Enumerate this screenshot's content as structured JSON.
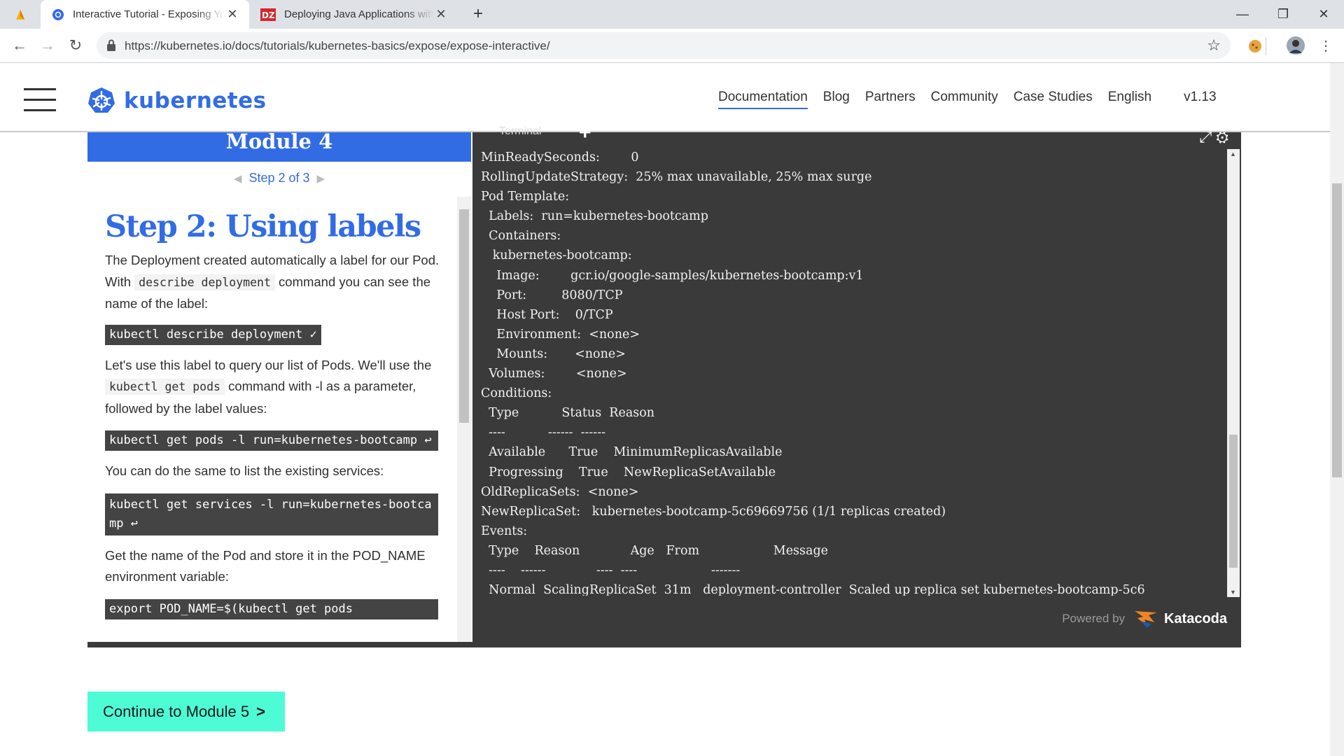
{
  "browser": {
    "tabs": [
      {
        "title": "Interactive Tutorial - Exposing Yo",
        "active": true
      },
      {
        "title": "Deploying Java Applications with",
        "active": false
      }
    ],
    "new_tab": "+",
    "url": "https://kubernetes.io/docs/tutorials/kubernetes-basics/expose/expose-interactive/"
  },
  "site": {
    "brand": "kubernetes",
    "nav": [
      "Documentation",
      "Blog",
      "Partners",
      "Community",
      "Case Studies",
      "English"
    ],
    "version": "v1.13"
  },
  "lesson": {
    "module": "Module 4",
    "step": "Step 2 of 3",
    "heading": "Step 2: Using labels",
    "p1_a": "The Deployment created automatically a label for our Pod. With ",
    "p1_code": "describe deployment",
    "p1_b": " command you can see the name of the label:",
    "cmd1": "kubectl describe deployment ✓",
    "p2_a": "Let's use this label to query our list of Pods. We'll use the ",
    "p2_code": "kubectl get pods",
    "p2_b": " command with -l as a parameter, followed by the label values:",
    "cmd2": "kubectl get pods -l run=kubernetes-bootcamp ↩",
    "p3": "You can do the same to list the existing services:",
    "cmd3": "kubectl get services -l run=kubernetes-bootcamp ↩",
    "p4": "Get the name of the Pod and store it in the POD_NAME environment variable:",
    "cmd4": "export POD_NAME=$(kubectl get pods"
  },
  "terminal": {
    "tab": "Terminal",
    "lines": [
      "MinReadySeconds:        0",
      "RollingUpdateStrategy:  25% max unavailable, 25% max surge",
      "Pod Template:",
      "  Labels:  run=kubernetes-bootcamp",
      "  Containers:",
      "   kubernetes-bootcamp:",
      "    Image:        gcr.io/google-samples/kubernetes-bootcamp:v1",
      "    Port:         8080/TCP",
      "    Host Port:    0/TCP",
      "    Environment:  <none>",
      "    Mounts:       <none>",
      "  Volumes:        <none>",
      "Conditions:",
      "  Type           Status  Reason",
      "  ----           ------  ------",
      "  Available      True    MinimumReplicasAvailable",
      "  Progressing    True    NewReplicaSetAvailable",
      "OldReplicaSets:  <none>",
      "NewReplicaSet:   kubernetes-bootcamp-5c69669756 (1/1 replicas created)",
      "Events:",
      "  Type    Reason             Age   From                   Message",
      "  ----    ------             ----  ----                   -------",
      "  Normal  ScalingReplicaSet  31m   deployment-controller  Scaled up replica set kubernetes-bootcamp-5c6"
    ],
    "powered_by": "Powered by",
    "katacoda": "Katacoda"
  },
  "continue_button": "Continue to Module 5",
  "colors": {
    "k8s_blue": "#326ce5",
    "continue_bg": "#4dfbd5",
    "terminal_bg": "#3a3a3a"
  },
  "icons": [
    "back-icon",
    "forward-icon",
    "reload-icon",
    "lock-icon",
    "star-icon",
    "extension-icon",
    "avatar",
    "menu-icon",
    "kubernetes-logo-icon",
    "expand-icon",
    "settings-icon"
  ]
}
